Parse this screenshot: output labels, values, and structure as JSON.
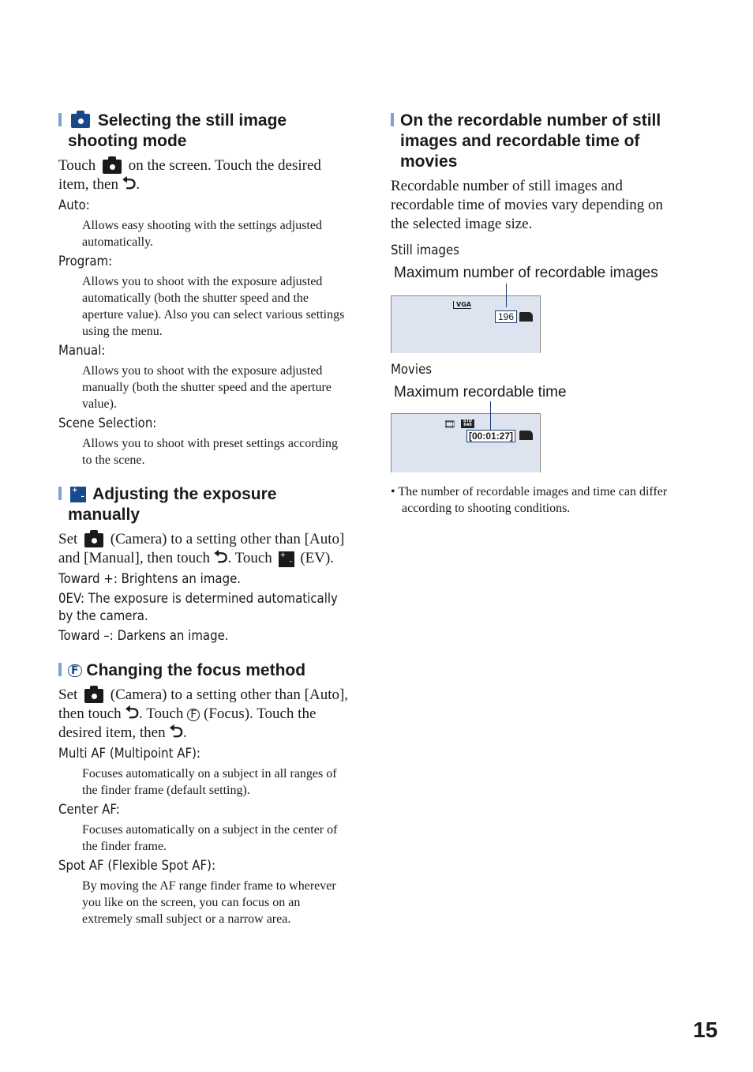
{
  "left": {
    "s1": {
      "title": "Selecting the still image shooting mode",
      "intro_a": "Touch",
      "intro_b": "on the screen. Touch the desired item, then",
      "intro_c": ".",
      "items": [
        {
          "term": "Auto:",
          "desc": "Allows easy shooting with the settings adjusted automatically."
        },
        {
          "term": "Program:",
          "desc": "Allows you to shoot with the exposure adjusted automatically (both the shutter speed and the aperture value). Also you can select various settings using the menu."
        },
        {
          "term": "Manual:",
          "desc": "Allows you to shoot with the exposure adjusted manually (both the shutter speed and the aperture value)."
        },
        {
          "term": "Scene Selection:",
          "desc": "Allows you to shoot with preset settings according to the scene."
        }
      ]
    },
    "s2": {
      "title": "Adjusting the exposure manually",
      "p_a": "Set",
      "p_b": "(Camera) to a setting other than [Auto] and [Manual], then touch",
      "p_c": ". Touch",
      "p_d": "(EV).",
      "lines": [
        "Toward +: Brightens an image.",
        "0EV: The exposure is determined automatically by the camera.",
        "Toward –: Darkens an image."
      ]
    },
    "s3": {
      "title": "Changing the focus method",
      "p_a": "Set",
      "p_b": "(Camera) to a setting other than [Auto], then touch",
      "p_c": ". Touch",
      "p_d": "(Focus). Touch the desired item, then",
      "p_e": ".",
      "items": [
        {
          "term": "Multi AF (Multipoint AF):",
          "desc": "Focuses automatically on a subject in all ranges of the finder frame (default setting)."
        },
        {
          "term": "Center AF:",
          "desc": "Focuses automatically on a subject in the center of the finder frame."
        },
        {
          "term": "Spot AF (Flexible Spot AF):",
          "desc": "By moving the AF range finder frame to wherever you like on the screen, you can focus on an extremely small subject or a narrow area."
        }
      ]
    }
  },
  "right": {
    "title": "On the recordable number of still images and recordable time of movies",
    "intro": "Recordable number of still images and recordable time of movies vary depending on the selected image size.",
    "still_label": "Still images",
    "still_callout": "Maximum number of recordable images",
    "still_size": "VGA",
    "still_count": "196",
    "movies_label": "Movies",
    "movies_callout": "Maximum recordable time",
    "movie_quality": "STD 640",
    "movie_time": "[00:01:27]",
    "note": "• The number of recordable images and time can differ according to shooting conditions."
  },
  "page_number": "15"
}
